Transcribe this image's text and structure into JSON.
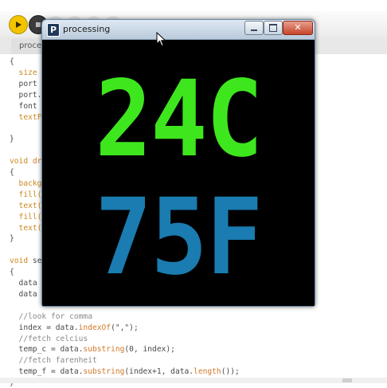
{
  "ide": {
    "tab_label": "proce",
    "code": [
      {
        "parts": [
          {
            "t": "{",
            "c": "def"
          }
        ]
      },
      {
        "parts": [
          {
            "t": "  size",
            "c": "kw"
          }
        ]
      },
      {
        "parts": [
          {
            "t": "  port",
            "c": "def"
          }
        ]
      },
      {
        "parts": [
          {
            "t": "  port.",
            "c": "def"
          }
        ]
      },
      {
        "parts": [
          {
            "t": "  font",
            "c": "def"
          }
        ]
      },
      {
        "parts": [
          {
            "t": "  textF",
            "c": "kw"
          }
        ]
      },
      {
        "parts": [
          {
            "t": "",
            "c": "def"
          }
        ]
      },
      {
        "parts": [
          {
            "t": "}",
            "c": "def"
          }
        ]
      },
      {
        "parts": [
          {
            "t": "",
            "c": "def"
          }
        ]
      },
      {
        "parts": [
          {
            "t": "void ",
            "c": "kw"
          },
          {
            "t": "dr",
            "c": "fn"
          }
        ]
      },
      {
        "parts": [
          {
            "t": "{",
            "c": "def"
          }
        ]
      },
      {
        "parts": [
          {
            "t": "  backg",
            "c": "kw"
          }
        ]
      },
      {
        "parts": [
          {
            "t": "  fill(",
            "c": "kw"
          }
        ]
      },
      {
        "parts": [
          {
            "t": "  text(",
            "c": "kw"
          }
        ]
      },
      {
        "parts": [
          {
            "t": "  fill(",
            "c": "kw"
          }
        ]
      },
      {
        "parts": [
          {
            "t": "  text(",
            "c": "kw"
          }
        ]
      },
      {
        "parts": [
          {
            "t": "}",
            "c": "def"
          }
        ]
      },
      {
        "parts": [
          {
            "t": "",
            "c": "def"
          }
        ]
      },
      {
        "parts": [
          {
            "t": "void ",
            "c": "kw"
          },
          {
            "t": "se",
            "c": "def"
          }
        ]
      },
      {
        "parts": [
          {
            "t": "{",
            "c": "def"
          }
        ]
      },
      {
        "parts": [
          {
            "t": "  data",
            "c": "def"
          }
        ]
      },
      {
        "parts": [
          {
            "t": "  data",
            "c": "def"
          }
        ]
      },
      {
        "parts": [
          {
            "t": "",
            "c": "def"
          }
        ]
      },
      {
        "parts": [
          {
            "t": "  //look for comma",
            "c": "com"
          }
        ]
      },
      {
        "parts": [
          {
            "t": "  index = data.",
            "c": "def"
          },
          {
            "t": "indexOf",
            "c": "fn"
          },
          {
            "t": "(\",\");",
            "c": "def"
          }
        ]
      },
      {
        "parts": [
          {
            "t": "  //fetch celcius",
            "c": "com"
          }
        ]
      },
      {
        "parts": [
          {
            "t": "  temp_c = data.",
            "c": "def"
          },
          {
            "t": "substring",
            "c": "fn"
          },
          {
            "t": "(0, index);",
            "c": "def"
          }
        ]
      },
      {
        "parts": [
          {
            "t": "  //fetch farenheit",
            "c": "com"
          }
        ]
      },
      {
        "parts": [
          {
            "t": "  temp_f = data.",
            "c": "def"
          },
          {
            "t": "substring",
            "c": "fn"
          },
          {
            "t": "(index+1, data.",
            "c": "def"
          },
          {
            "t": "length",
            "c": "fn"
          },
          {
            "t": "());",
            "c": "def"
          }
        ]
      },
      {
        "parts": [
          {
            "t": "}",
            "c": "def"
          }
        ]
      }
    ]
  },
  "sketch": {
    "title": "processing",
    "app_icon_letter": "P",
    "close_glyph": "✕",
    "celsius_text": "24C",
    "fahrenheit_text": "75F",
    "colors": {
      "celsius": "#3ee61e",
      "fahrenheit": "#1a7cb0",
      "background": "#000000"
    }
  }
}
